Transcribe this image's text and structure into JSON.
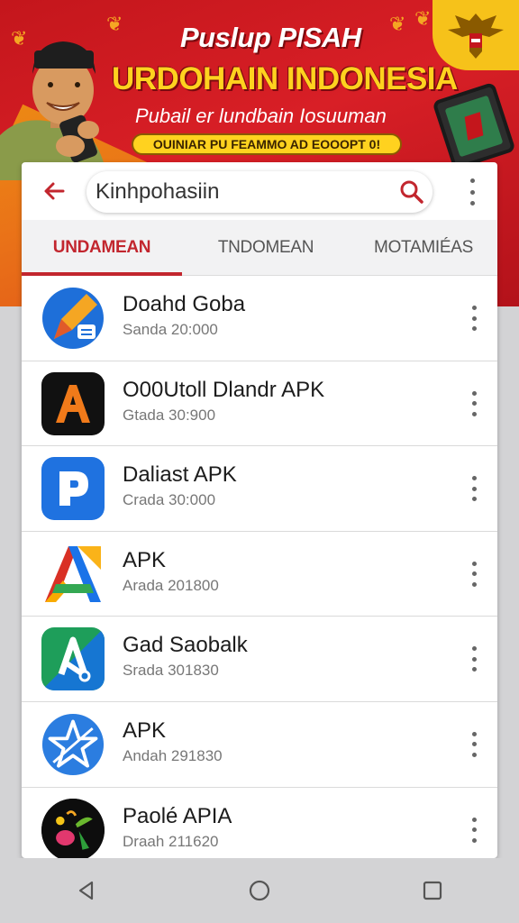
{
  "banner": {
    "title": "Puslup PISAH",
    "headline": "URDOHAIN INDONESIA",
    "subtitle": "Pubail er lundbain Iosuuman",
    "pill": "OUINIAR PU FEAMMO AD EOOOPT 0!"
  },
  "search": {
    "value": "Kinhpohasiin",
    "placeholder": ""
  },
  "tabs": [
    {
      "label": "UNDAMEAN",
      "active": true
    },
    {
      "label": "TNDOMEAN",
      "active": false
    },
    {
      "label": "MOTAMIÉAS",
      "active": false
    }
  ],
  "apps": [
    {
      "name": "Doahd Goba",
      "meta": "Sanda 20:000",
      "icon": "pencil-app-icon"
    },
    {
      "name": "O00Utoll Dlandr APK",
      "meta": "Gtada 30:900",
      "icon": "letter-a-app-icon"
    },
    {
      "name": "Daliast APK",
      "meta": "Crada 30:000",
      "icon": "letter-p-app-icon"
    },
    {
      "name": "APK",
      "meta": "Arada 201800",
      "icon": "colorful-a-app-icon"
    },
    {
      "name": "Gad Saobalk",
      "meta": "Srada 301830",
      "icon": "pen-tool-app-icon"
    },
    {
      "name": "APK",
      "meta": "Andah 291830",
      "icon": "star-compass-app-icon"
    },
    {
      "name": "Paolé APIA",
      "meta": "Draah 211620",
      "icon": "fruit-app-icon"
    }
  ],
  "colors": {
    "accent": "#c2262e",
    "banner_red": "#c4161c",
    "banner_yellow": "#ffd21f"
  }
}
